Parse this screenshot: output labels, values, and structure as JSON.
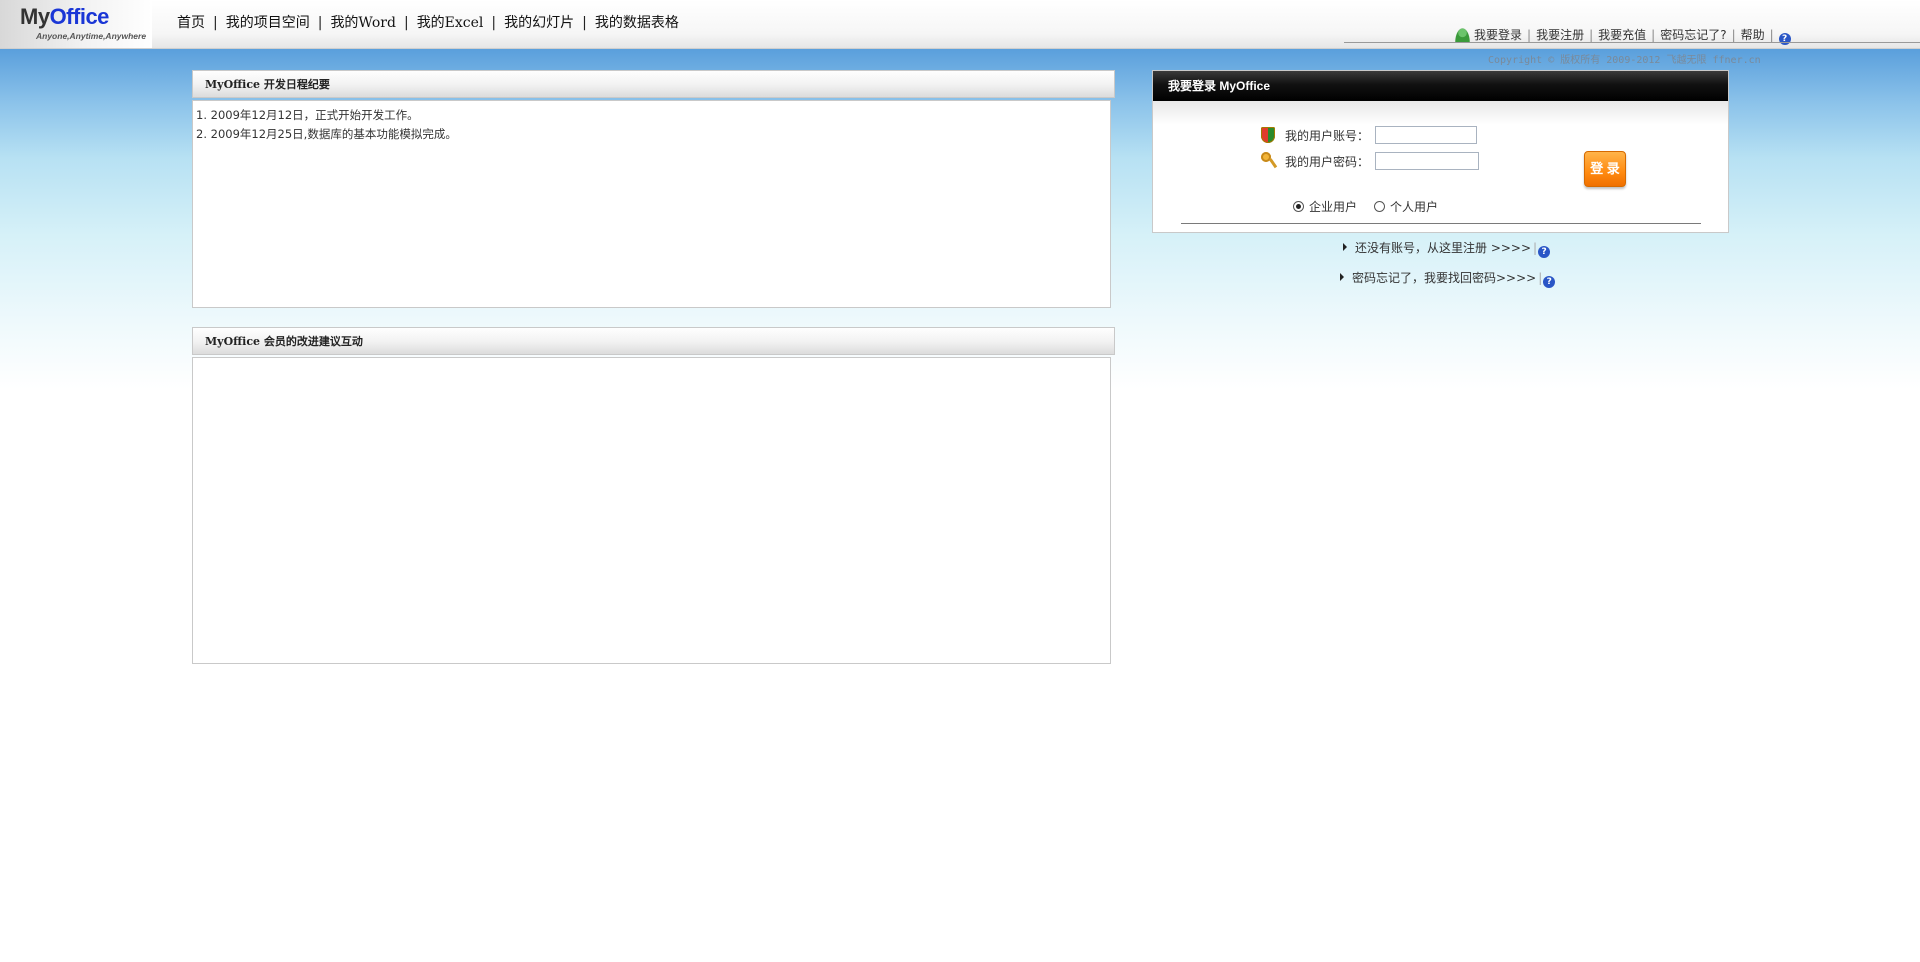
{
  "header": {
    "logo": {
      "my": "My",
      "office": "Office",
      "slogan": "Anyone,Anytime,Anywhere"
    },
    "nav": [
      {
        "label": "首页"
      },
      {
        "label": "我的项目空间"
      },
      {
        "label": "我的Word"
      },
      {
        "label": "我的Excel"
      },
      {
        "label": "我的幻灯片"
      },
      {
        "label": "我的数据表格"
      }
    ],
    "nav_separator": "|",
    "top_links": [
      {
        "label": "我要登录"
      },
      {
        "label": "我要注册"
      },
      {
        "label": "我要充值"
      },
      {
        "label": "密码忘记了?"
      },
      {
        "label": "帮助"
      }
    ],
    "top_separator": "|",
    "help_icon_glyph": "?",
    "copyright": "Copyright © 版权所有 2009-2012 飞越无限 ffner.cn"
  },
  "schedule_panel": {
    "title": "MyOffice 开发日程纪要",
    "items": [
      "1. 2009年12月12日，正式开始开发工作。",
      "2. 2009年12月25日,数据库的基本功能模拟完成。"
    ]
  },
  "suggestion_panel": {
    "title": "MyOffice 会员的改进建议互动"
  },
  "login": {
    "title": "我要登录 MyOffice",
    "username_label": "我的用户账号：",
    "username_value": "",
    "password_label": "我的用户密码：",
    "password_value": "",
    "submit_label": "登 录",
    "user_types": [
      {
        "label": "企业用户",
        "selected": true
      },
      {
        "label": "个人用户",
        "selected": false
      }
    ],
    "register_link": "还没有账号，从这里注册 >>>>",
    "forgot_link": "密码忘记了，我要找回密码>>>>"
  },
  "colors": {
    "brand_blue": "#1a36d6",
    "login_button": "#ff8a10",
    "login_header": "#000000",
    "sky_top": "#5a9fdc"
  }
}
